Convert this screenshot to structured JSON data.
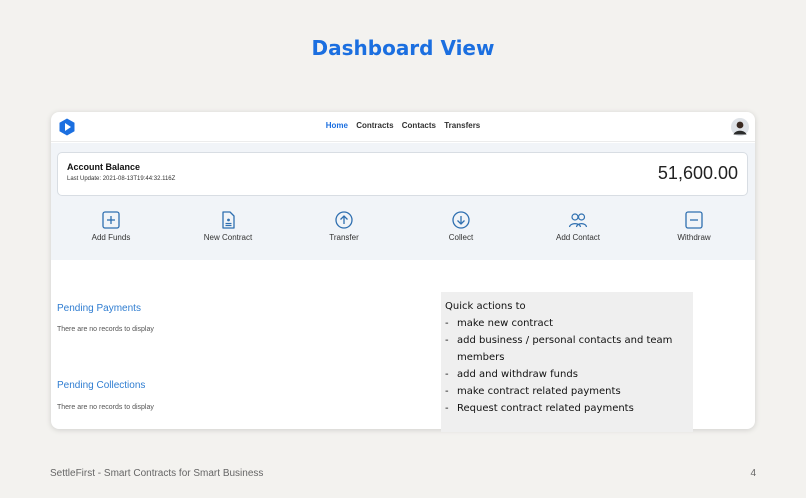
{
  "slide": {
    "title": "Dashboard View",
    "footer_left": "SettleFirst - Smart Contracts for Smart Business",
    "page_number": "4"
  },
  "nav": {
    "items": [
      {
        "label": "Home",
        "active": true
      },
      {
        "label": "Contracts",
        "active": false
      },
      {
        "label": "Contacts",
        "active": false
      },
      {
        "label": "Transfers",
        "active": false
      }
    ]
  },
  "account": {
    "label": "Account Balance",
    "last_update": "Last Update: 2021-08-13T19:44:32.116Z",
    "balance": "51,600.00"
  },
  "actions": [
    {
      "label": "Add Funds",
      "icon": "plus-square-icon"
    },
    {
      "label": "New Contract",
      "icon": "document-icon"
    },
    {
      "label": "Transfer",
      "icon": "arrow-up-circle-icon"
    },
    {
      "label": "Collect",
      "icon": "arrow-down-circle-icon"
    },
    {
      "label": "Add Contact",
      "icon": "users-icon"
    },
    {
      "label": "Withdraw",
      "icon": "minus-square-icon"
    }
  ],
  "pending_payments": {
    "title": "Pending Payments",
    "empty": "There are no records to display"
  },
  "pending_collections": {
    "title": "Pending Collections",
    "empty": "There are no records to display"
  },
  "note": {
    "heading": "Quick actions to",
    "items": [
      "make new contract",
      "add business / personal contacts and team members",
      "add and withdraw funds",
      "make contract related payments",
      "Request contract related payments"
    ]
  },
  "colors": {
    "accent": "#1b6fe0",
    "section_title": "#2f7dd1",
    "panel_bg": "#f1f4f8",
    "icon": "#2f6fb0"
  }
}
